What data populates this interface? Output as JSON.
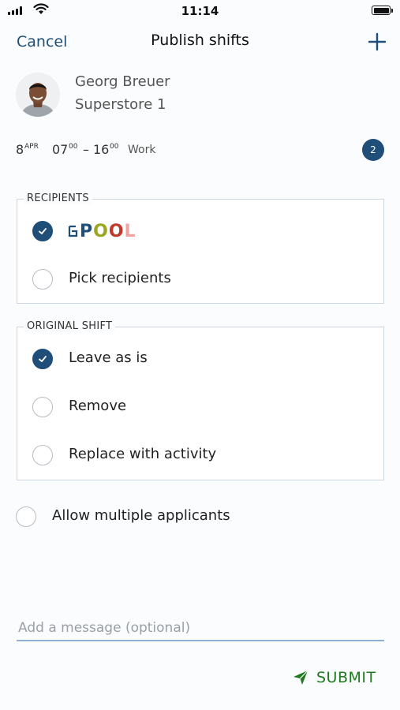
{
  "status_bar": {
    "time": "11:14"
  },
  "nav": {
    "cancel_label": "Cancel",
    "title": "Publish shifts",
    "add_icon": "plus-icon"
  },
  "employee": {
    "name": "Georg Breuer",
    "store": "Superstore 1"
  },
  "shift": {
    "day": "8",
    "month": "APR",
    "start_hour": "07",
    "start_min": "00",
    "dash": "–",
    "end_hour": "16",
    "end_min": "00",
    "type": "Work",
    "count_badge": "2"
  },
  "recipients": {
    "legend": "RECIPIENTS",
    "options": [
      {
        "label": "POOL",
        "logo_text": "POOL",
        "checked": true
      },
      {
        "label": "Pick recipients",
        "checked": false
      }
    ]
  },
  "original_shift": {
    "legend": "ORIGINAL SHIFT",
    "options": [
      {
        "label": "Leave as is",
        "checked": true
      },
      {
        "label": "Remove",
        "checked": false
      },
      {
        "label": "Replace with activity",
        "checked": false
      }
    ]
  },
  "allow_multiple": {
    "label": "Allow multiple applicants",
    "checked": false
  },
  "message": {
    "placeholder": "Add a message (optional)",
    "value": ""
  },
  "submit_label": "SUBMIT",
  "colors": {
    "accent": "#1f4e79",
    "submit": "#1f7a1f",
    "border": "#cdd6e0"
  }
}
